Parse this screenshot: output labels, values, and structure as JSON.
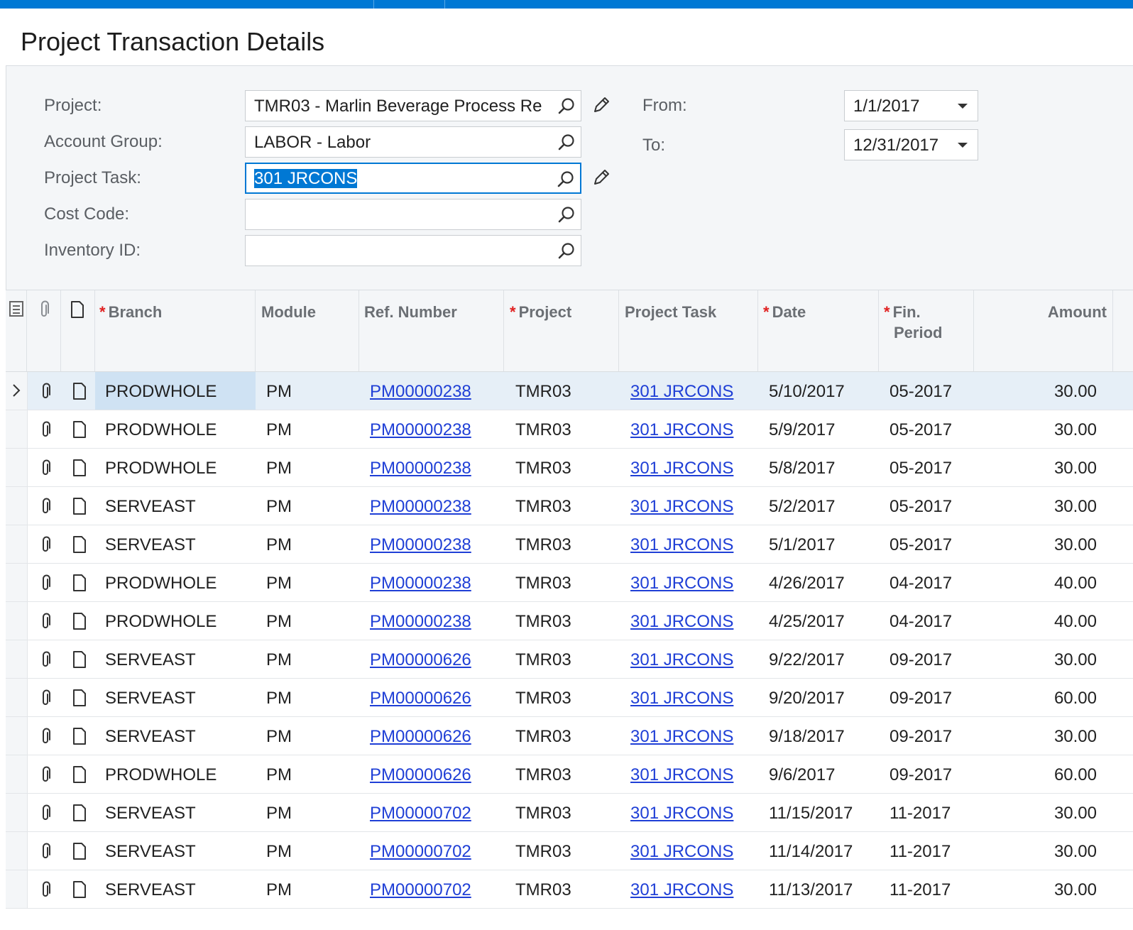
{
  "page": {
    "title": "Project Transaction Details"
  },
  "filters": {
    "project_label": "Project:",
    "project_value": "TMR03 - Marlin Beverage Process Re",
    "account_group_label": "Account Group:",
    "account_group_value": "LABOR - Labor",
    "project_task_label": "Project Task:",
    "project_task_value": "301 JRCONS",
    "cost_code_label": "Cost Code:",
    "cost_code_value": "",
    "inventory_id_label": "Inventory ID:",
    "inventory_id_value": "",
    "from_label": "From:",
    "from_value": "1/1/2017",
    "to_label": "To:",
    "to_value": "12/31/2017"
  },
  "grid": {
    "columns": {
      "branch": "Branch",
      "module": "Module",
      "ref_number": "Ref. Number",
      "project": "Project",
      "project_task": "Project Task",
      "date": "Date",
      "fin_period_1": "Fin.",
      "fin_period_2": "Period",
      "amount": "Amount"
    },
    "rows": [
      {
        "branch": "PRODWHOLE",
        "module": "PM",
        "ref": "PM00000238",
        "project": "TMR03",
        "task": "301 JRCONS",
        "date": "5/10/2017",
        "period": "05-2017",
        "amount": "30.00"
      },
      {
        "branch": "PRODWHOLE",
        "module": "PM",
        "ref": "PM00000238",
        "project": "TMR03",
        "task": "301 JRCONS",
        "date": "5/9/2017",
        "period": "05-2017",
        "amount": "30.00"
      },
      {
        "branch": "PRODWHOLE",
        "module": "PM",
        "ref": "PM00000238",
        "project": "TMR03",
        "task": "301 JRCONS",
        "date": "5/8/2017",
        "period": "05-2017",
        "amount": "30.00"
      },
      {
        "branch": "SERVEAST",
        "module": "PM",
        "ref": "PM00000238",
        "project": "TMR03",
        "task": "301 JRCONS",
        "date": "5/2/2017",
        "period": "05-2017",
        "amount": "30.00"
      },
      {
        "branch": "SERVEAST",
        "module": "PM",
        "ref": "PM00000238",
        "project": "TMR03",
        "task": "301 JRCONS",
        "date": "5/1/2017",
        "period": "05-2017",
        "amount": "30.00"
      },
      {
        "branch": "PRODWHOLE",
        "module": "PM",
        "ref": "PM00000238",
        "project": "TMR03",
        "task": "301 JRCONS",
        "date": "4/26/2017",
        "period": "04-2017",
        "amount": "40.00"
      },
      {
        "branch": "PRODWHOLE",
        "module": "PM",
        "ref": "PM00000238",
        "project": "TMR03",
        "task": "301 JRCONS",
        "date": "4/25/2017",
        "period": "04-2017",
        "amount": "40.00"
      },
      {
        "branch": "SERVEAST",
        "module": "PM",
        "ref": "PM00000626",
        "project": "TMR03",
        "task": "301 JRCONS",
        "date": "9/22/2017",
        "period": "09-2017",
        "amount": "30.00"
      },
      {
        "branch": "SERVEAST",
        "module": "PM",
        "ref": "PM00000626",
        "project": "TMR03",
        "task": "301 JRCONS",
        "date": "9/20/2017",
        "period": "09-2017",
        "amount": "60.00"
      },
      {
        "branch": "SERVEAST",
        "module": "PM",
        "ref": "PM00000626",
        "project": "TMR03",
        "task": "301 JRCONS",
        "date": "9/18/2017",
        "period": "09-2017",
        "amount": "30.00"
      },
      {
        "branch": "PRODWHOLE",
        "module": "PM",
        "ref": "PM00000626",
        "project": "TMR03",
        "task": "301 JRCONS",
        "date": "9/6/2017",
        "period": "09-2017",
        "amount": "60.00"
      },
      {
        "branch": "SERVEAST",
        "module": "PM",
        "ref": "PM00000702",
        "project": "TMR03",
        "task": "301 JRCONS",
        "date": "11/15/2017",
        "period": "11-2017",
        "amount": "30.00"
      },
      {
        "branch": "SERVEAST",
        "module": "PM",
        "ref": "PM00000702",
        "project": "TMR03",
        "task": "301 JRCONS",
        "date": "11/14/2017",
        "period": "11-2017",
        "amount": "30.00"
      },
      {
        "branch": "SERVEAST",
        "module": "PM",
        "ref": "PM00000702",
        "project": "TMR03",
        "task": "301 JRCONS",
        "date": "11/13/2017",
        "period": "11-2017",
        "amount": "30.00"
      }
    ]
  }
}
